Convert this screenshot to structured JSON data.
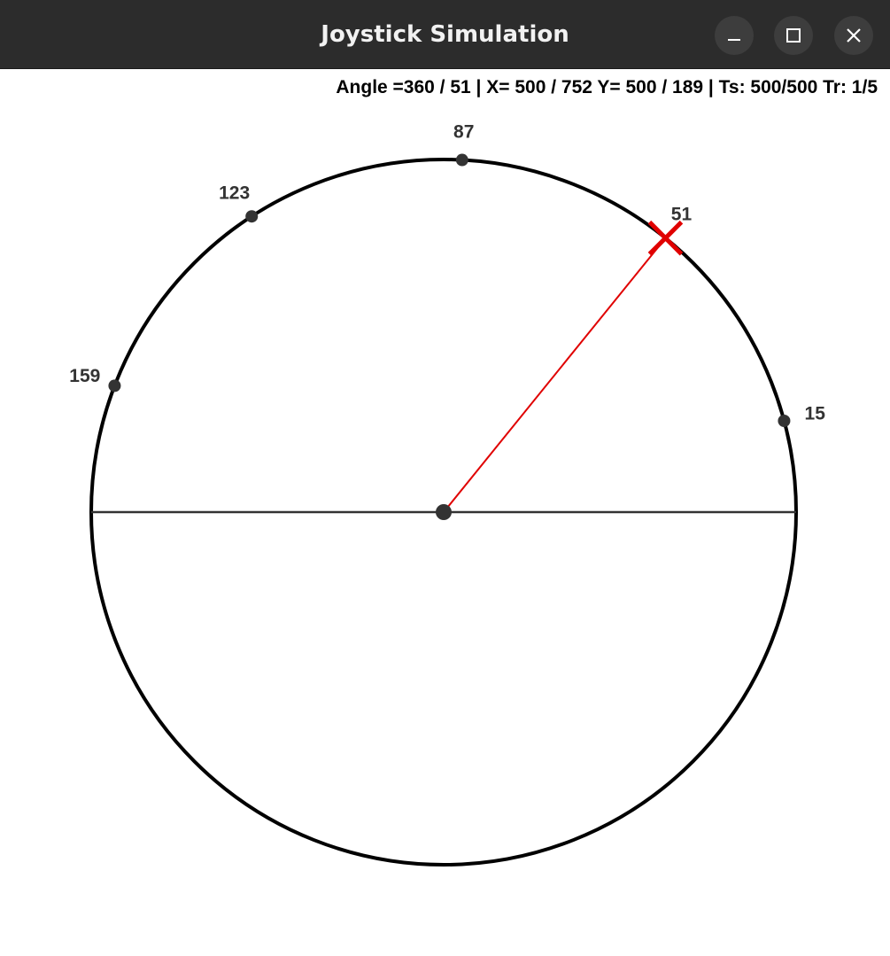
{
  "window": {
    "title": "Joystick Simulation"
  },
  "status_text": "Angle =360 / 51 | X= 500 / 752 Y= 500 / 189 | Ts: 500/500 Tr: 1/5",
  "dial": {
    "markers": [
      {
        "label": "87",
        "angle": 87
      },
      {
        "label": "123",
        "angle": 123
      },
      {
        "label": "159",
        "angle": 159
      },
      {
        "label": "15",
        "angle": 15
      },
      {
        "label": "51",
        "angle": 51
      }
    ],
    "target": {
      "label": "51",
      "angle": 51
    },
    "colors": {
      "circle": "#000000",
      "marker": "#333333",
      "pointer": "#e00000",
      "axis": "#333333"
    }
  }
}
